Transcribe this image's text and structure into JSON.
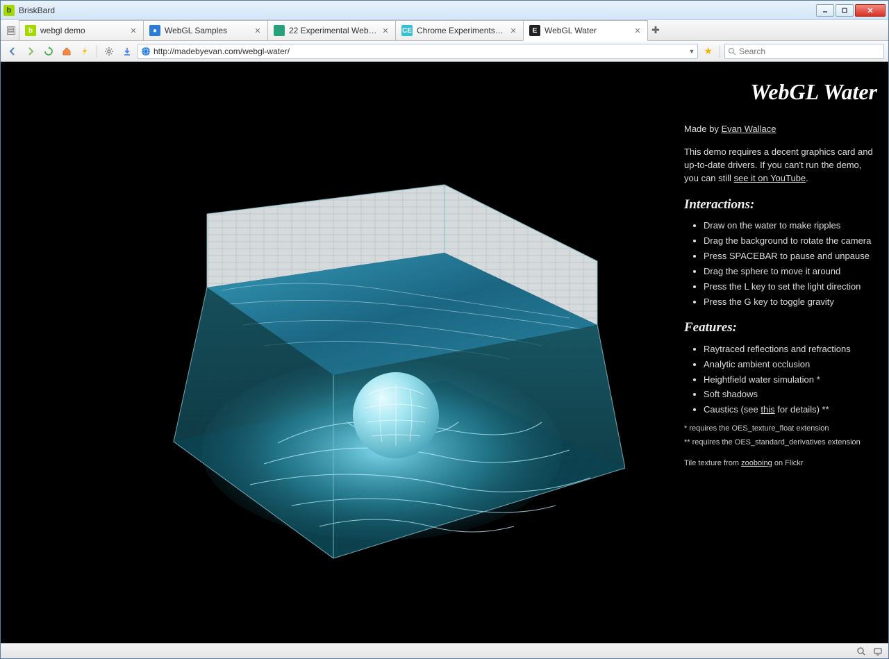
{
  "window": {
    "title": "BriskBard"
  },
  "tabs": [
    {
      "label": "webgl demo",
      "color": "#a3d900",
      "glyph": "b",
      "active": false
    },
    {
      "label": "WebGL Samples",
      "color": "#2b7bd9",
      "glyph": "●",
      "active": false
    },
    {
      "label": "22 Experimental WebGL D…",
      "color": "#28a07c",
      "glyph": "",
      "active": false
    },
    {
      "label": "Chrome Experiments - We…",
      "color": "#35c1d6",
      "glyph": "CE",
      "active": false
    },
    {
      "label": "WebGL Water",
      "color": "#222",
      "glyph": "E",
      "active": true
    }
  ],
  "toolbar": {
    "url": "http://madebyevan.com/webgl-water/",
    "search_placeholder": "Search"
  },
  "page": {
    "title": "WebGL Water",
    "byline_prefix": "Made by ",
    "byline_link": "Evan Wallace",
    "desc_1": "This demo requires a decent graphics card and up-to-date drivers. If you can't run the demo, you can still ",
    "desc_link": "see it on YouTube",
    "desc_1_suffix": ".",
    "interactions_h": "Interactions:",
    "interactions": [
      "Draw on the water to make ripples",
      "Drag the background to rotate the camera",
      "Press SPACEBAR to pause and unpause",
      "Drag the sphere to move it around",
      "Press the L key to set the light direction",
      "Press the G key to toggle gravity"
    ],
    "features_h": "Features:",
    "features": [
      "Raytraced reflections and refractions",
      "Analytic ambient occlusion",
      "Heightfield water simulation *",
      "Soft shadows"
    ],
    "caustics_prefix": "Caustics (see ",
    "caustics_link": "this",
    "caustics_suffix": " for details) **",
    "fn1": "* requires the OES_texture_float extension",
    "fn2": "** requires the OES_standard_derivatives extension",
    "credit_prefix": "Tile texture from ",
    "credit_link": "zooboing",
    "credit_suffix": " on Flickr"
  }
}
